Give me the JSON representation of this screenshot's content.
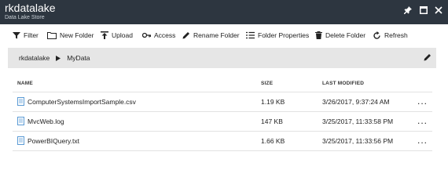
{
  "titlebar": {
    "title": "rkdatalake",
    "subtitle": "Data Lake Store",
    "controls": [
      "pin-icon",
      "maximize-icon",
      "close-icon"
    ]
  },
  "toolbar": {
    "filter": "Filter",
    "new_folder": "New Folder",
    "upload": "Upload",
    "access": "Access",
    "rename_folder": "Rename Folder",
    "folder_properties": "Folder Properties",
    "delete_folder": "Delete Folder",
    "refresh": "Refresh"
  },
  "breadcrumb": {
    "items": [
      "rkdatalake",
      "MyData"
    ]
  },
  "table": {
    "columns": [
      "NAME",
      "SIZE",
      "LAST MODIFIED"
    ],
    "rows": [
      {
        "name": "ComputerSystemsImportSample.csv",
        "size": "1.19 KB",
        "modified": "3/26/2017, 9:37:24 AM",
        "more": "..."
      },
      {
        "name": "MvcWeb.log",
        "size": "147 KB",
        "modified": "3/25/2017, 11:33:58 PM",
        "more": "..."
      },
      {
        "name": "PowerBIQuery.txt",
        "size": "1.66 KB",
        "modified": "3/25/2017, 11:33:56 PM",
        "more": "..."
      }
    ]
  },
  "colors": {
    "titlebar_bg": "#2d3640",
    "breadcrumb_bg": "#e6e6e6",
    "file_icon": "#5b9bd5"
  }
}
